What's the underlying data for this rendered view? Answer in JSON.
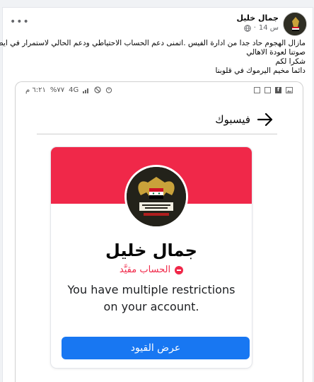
{
  "post": {
    "author": "جمال خليل",
    "time": "14 س",
    "text_lines": [
      "مازال الهجوم حاد جدا من ادارة الفيس .اتمنى دعم الحساب الاحتياطي ودعم الحالي لاستمرار في ايصال",
      "صوتنا لعودة الاهالي",
      "شكرا لكم",
      "دائما مخيم اليرموك في قلوبنا"
    ]
  },
  "screenshot": {
    "status": {
      "time": "٦:٢١ م",
      "battery": "%٧٧",
      "network": "4G"
    },
    "nav_title": "فيسبوك",
    "profile_name": "جمال خليل",
    "restricted_label": "الحساب مقيَّد",
    "restriction_message": "You have multiple restrictions on your account.",
    "cta_label": "عرض القيود"
  },
  "colors": {
    "cover": "#f02849",
    "primary": "#1877f2",
    "warning": "#f02849"
  }
}
